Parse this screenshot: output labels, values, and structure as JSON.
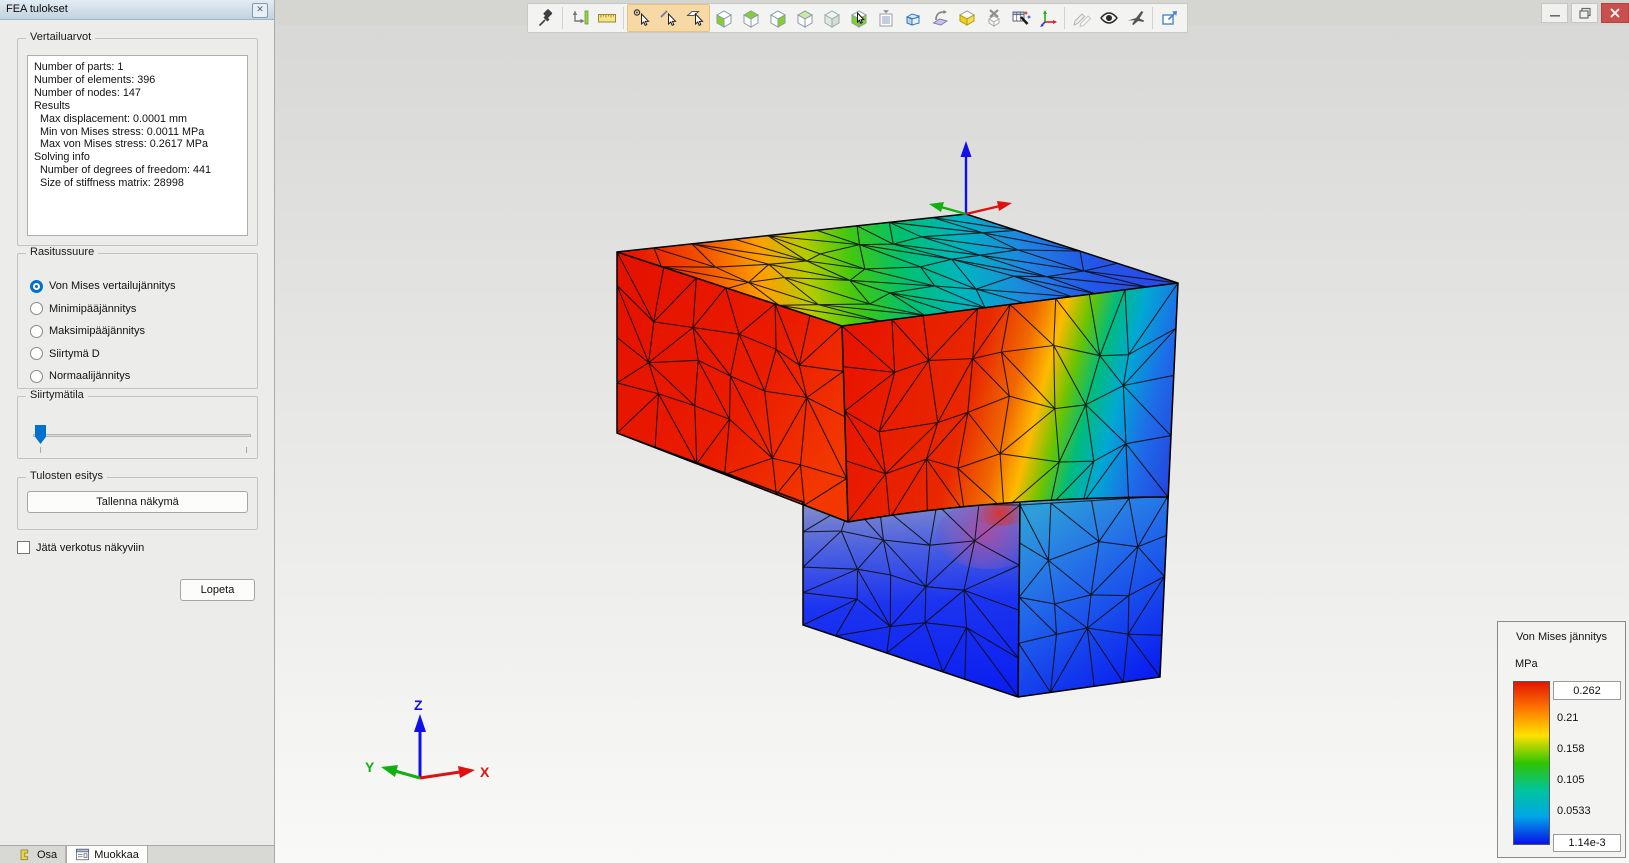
{
  "window": {
    "controls": [
      {
        "name": "minimize-button"
      },
      {
        "name": "maximize-button"
      },
      {
        "name": "close-button"
      }
    ]
  },
  "toolbar": {
    "items": [
      {
        "icon": "pin-icon"
      },
      {
        "sep": true
      },
      {
        "icon": "zoom-fit-icon"
      },
      {
        "icon": "ruler-icon"
      },
      {
        "sep": true
      },
      {
        "icon": "select-point-cursor-icon",
        "highlighted": true
      },
      {
        "icon": "select-edge-cursor-icon",
        "highlighted": true
      },
      {
        "icon": "select-face-cursor-icon",
        "highlighted": true
      },
      {
        "icon": "view-front-cube-icon"
      },
      {
        "icon": "view-top-cube-icon"
      },
      {
        "icon": "view-left-cube-icon"
      },
      {
        "icon": "view-back-cube-icon"
      },
      {
        "icon": "shaded-view-cube-icon"
      },
      {
        "icon": "rotate-view-cube-icon"
      },
      {
        "icon": "document-list-icon"
      },
      {
        "icon": "extrude-model-icon"
      },
      {
        "icon": "sheet-bend-icon"
      },
      {
        "icon": "section-box-icon"
      },
      {
        "icon": "delete-feature-icon"
      },
      {
        "icon": "table-wand-icon"
      },
      {
        "icon": "coordinate-axes-icon"
      },
      {
        "sep": true
      },
      {
        "icon": "draft-pencils-icon"
      },
      {
        "icon": "eye-icon"
      },
      {
        "icon": "airplane-icon"
      },
      {
        "sep": true
      },
      {
        "icon": "export-view-icon"
      }
    ],
    "highlight_color": "#f6d9a4"
  },
  "panel": {
    "title": "FEA tulokset",
    "groups": {
      "vertailuarvot": {
        "label": "Vertailuarvot",
        "lines": [
          "Number of parts: 1",
          "Number of elements: 396",
          "Number of nodes: 147",
          "Results",
          "  Max displacement: 0.0001 mm",
          "  Min von Mises stress: 0.0011 MPa",
          "  Max von Mises stress: 0.2617 MPa",
          "Solving info",
          "  Number of degrees of freedom: 441",
          "  Size of stiffness matrix: 28998"
        ]
      },
      "rasitussuure": {
        "label": "Rasitussuure",
        "options": [
          {
            "label": "Von Mises vertailujännitys",
            "selected": true
          },
          {
            "label": "Minimipääjännitys",
            "selected": false
          },
          {
            "label": "Maksimipääjännitys",
            "selected": false
          },
          {
            "label": "Siirtymä D",
            "selected": false
          },
          {
            "label": "Normaalijännitys",
            "selected": false
          }
        ]
      },
      "siirtymatila": {
        "label": "Siirtymätila",
        "slider_percent": 2
      },
      "tulosten_esitys": {
        "label": "Tulosten esitys",
        "button_label": "Tallenna näkymä"
      }
    },
    "mesh_checkbox": {
      "label": "Jätä verkotus näkyviin",
      "checked": false
    },
    "close_button_label": "Lopeta"
  },
  "tabs": [
    {
      "label": "Osa",
      "icon": "part-icon",
      "active": false
    },
    {
      "label": "Muokkaa",
      "icon": "edit-icon",
      "active": true
    }
  ],
  "viewport": {
    "triad": {
      "x": "X",
      "y": "Y",
      "z": "Z",
      "x_color": "#e01010",
      "y_color": "#10b010",
      "z_color": "#1010e8"
    },
    "model_description": "L-shaped stepped block, von Mises stress result, triangular FEA mesh"
  },
  "legend": {
    "title": "Von Mises jännitys",
    "unit": "MPa",
    "max_value": "0.262",
    "tick_values": [
      "0.21",
      "0.158",
      "0.105",
      "0.0533"
    ],
    "min_value": "1.14e-3",
    "scale_colors": [
      "#e31500",
      "#ff7a00",
      "#ffe100",
      "#2fc400",
      "#00c49e",
      "#00a6e8",
      "#0813e8"
    ]
  }
}
